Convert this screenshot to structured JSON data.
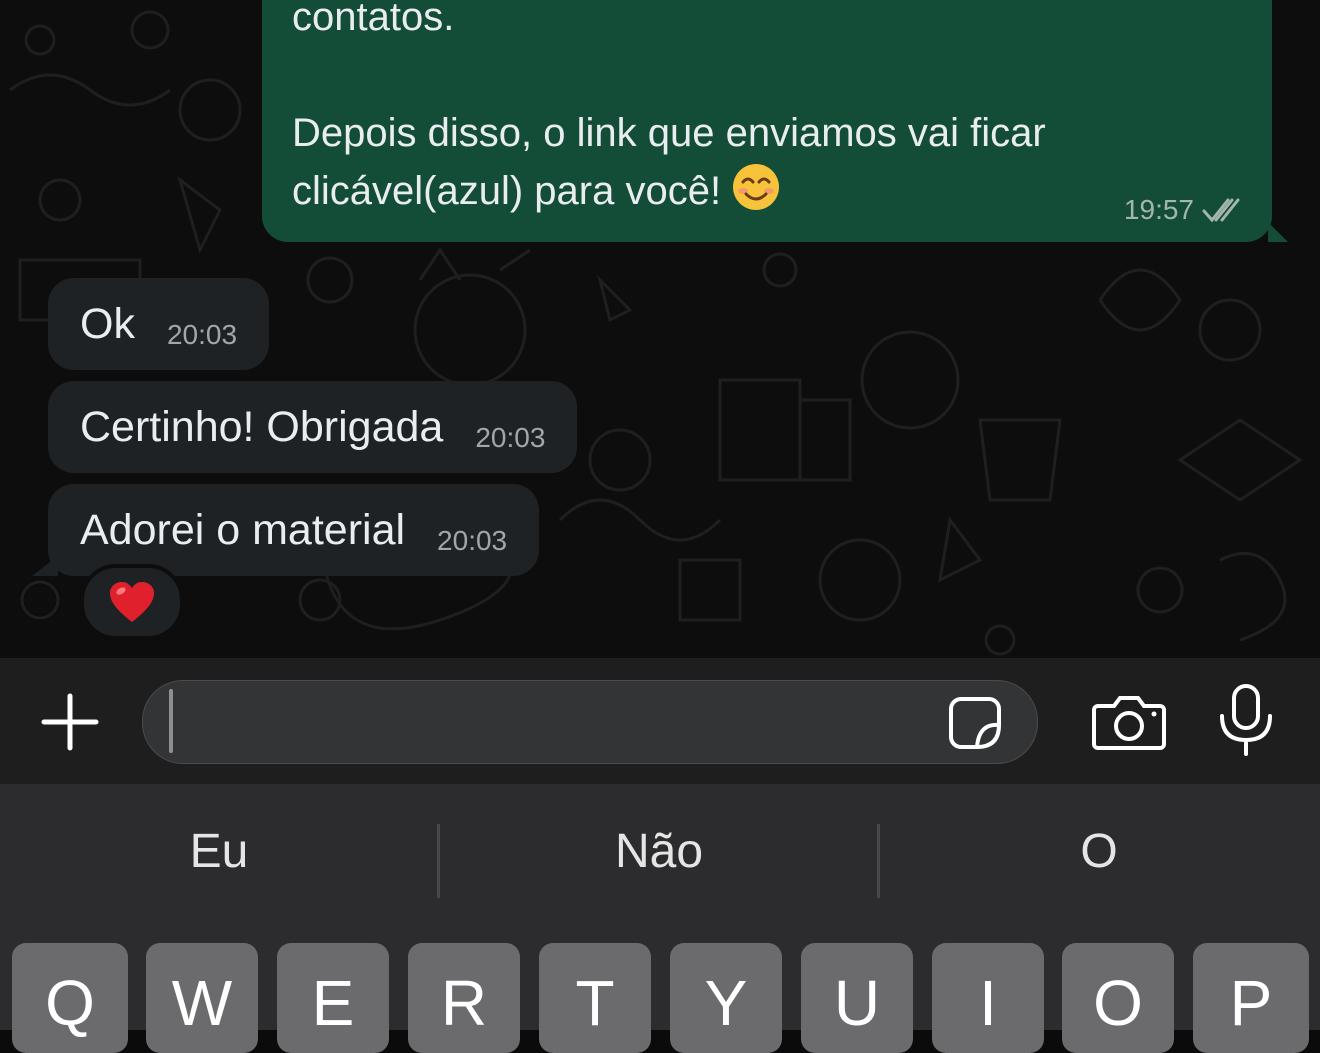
{
  "messages": {
    "outgoing": {
      "text": "contatos.\n\nDepois disso, o link que enviamos vai ficar\nclicável(azul) para você!",
      "time": "19:57"
    },
    "incoming": [
      {
        "text": "Ok",
        "time": "20:03"
      },
      {
        "text": "Certinho! Obrigada",
        "time": "20:03"
      },
      {
        "text": "Adorei o material",
        "time": "20:03"
      }
    ],
    "reaction": "heart-emoji"
  },
  "composer": {
    "input_value": "",
    "icons": [
      "plus-icon",
      "sticker-icon",
      "camera-icon",
      "microphone-icon"
    ]
  },
  "keyboard": {
    "suggestions": [
      "Eu",
      "Não",
      "O"
    ],
    "keys": [
      "Q",
      "W",
      "E",
      "R",
      "T",
      "Y",
      "U",
      "I",
      "O",
      "P"
    ]
  },
  "colors": {
    "outgoing_bubble": "#144d37",
    "incoming_bubble": "#1f2225",
    "chat_background": "#0d0d0d",
    "read_ticks": "#a3b5ac"
  }
}
